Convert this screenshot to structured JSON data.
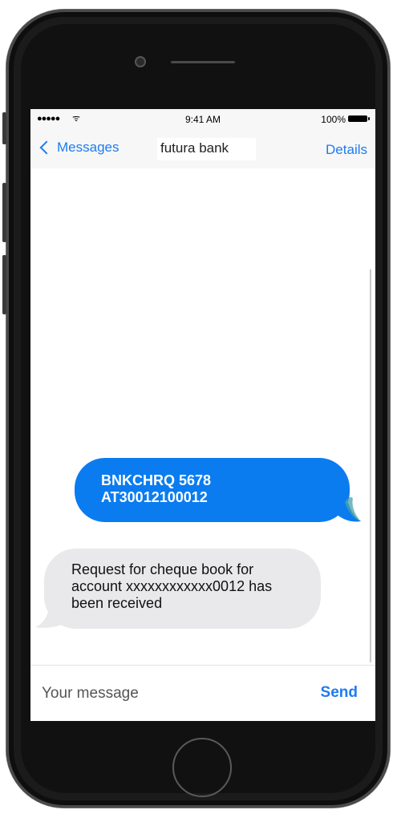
{
  "status_bar": {
    "signal": "●●●●●",
    "wifi": "ᯤ",
    "time": "9:41 AM",
    "battery": "100%"
  },
  "nav": {
    "back_label": "Messages",
    "contact": "futura bank",
    "details_label": "Details"
  },
  "messages": [
    {
      "direction": "outgoing",
      "lines": [
        "BNKCHRQ 5678",
        "AT30012100012"
      ]
    },
    {
      "direction": "incoming",
      "lines": [
        "Request for cheque book for",
        "account xxxxxxxxxxxx0012 has",
        "been received"
      ]
    }
  ],
  "composer": {
    "placeholder": "Your message",
    "value": "",
    "send_label": "Send"
  },
  "colors": {
    "accent": "#1e7cf0",
    "outgoing_bubble": "#0a7cf0",
    "incoming_bubble": "#e9e9eb"
  }
}
